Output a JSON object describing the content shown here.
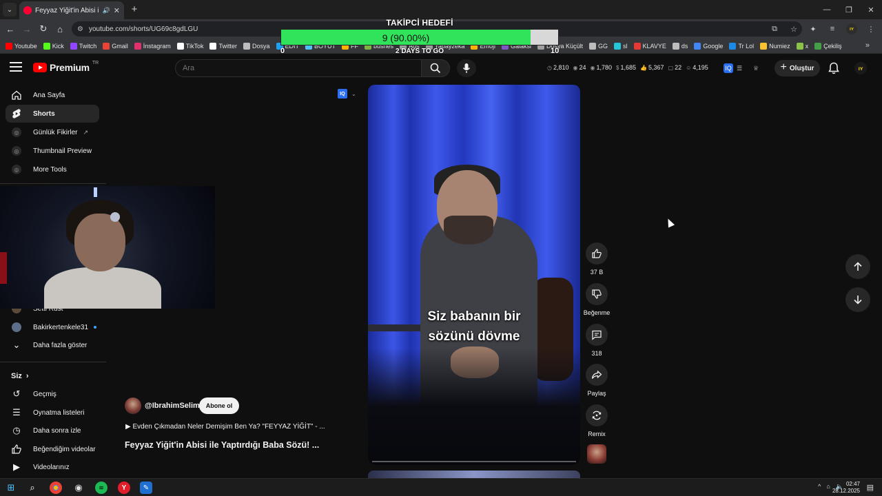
{
  "browser": {
    "tab_title": "Feyyaz Yiğit'in Abisi ile Yaptı",
    "url": "youtube.com/shorts/UG69c8gdLGU",
    "bookmarks": [
      {
        "label": "Youtube",
        "color": "#ff0000"
      },
      {
        "label": "Kick",
        "color": "#53fc18"
      },
      {
        "label": "Twitch",
        "color": "#9146ff"
      },
      {
        "label": "Gmail",
        "color": "#ea4335"
      },
      {
        "label": "İnstagram",
        "color": "#e1306c"
      },
      {
        "label": "TikTok",
        "color": "#ffffff"
      },
      {
        "label": "Twitter",
        "color": "#ffffff"
      },
      {
        "label": "Dosya",
        "color": "#bdbdbd"
      },
      {
        "label": "EDIT",
        "color": "#1da1f2"
      },
      {
        "label": "BOYUT",
        "color": "#4fc3f7"
      },
      {
        "label": "FF",
        "color": "#ffb300"
      },
      {
        "label": "bushes",
        "color": "#7cb342"
      },
      {
        "label": "Ads",
        "color": "#9e9e9e"
      },
      {
        "label": "Yapayzeka",
        "color": "#9e9e9e"
      },
      {
        "label": "Emoji",
        "color": "#ffb300"
      },
      {
        "label": "Galaksi",
        "color": "#7e57c2"
      },
      {
        "label": "Dosya Küçült",
        "color": "#9e9e9e"
      },
      {
        "label": "GG",
        "color": "#bdbdbd"
      },
      {
        "label": "sl",
        "color": "#26c6da"
      },
      {
        "label": "KLAVYE",
        "color": "#e53935"
      },
      {
        "label": "ds",
        "color": "#bdbdbd"
      },
      {
        "label": "Google",
        "color": "#4285f4"
      },
      {
        "label": "Tr Lol",
        "color": "#1e88e5"
      },
      {
        "label": "Numiez",
        "color": "#fbc02d"
      },
      {
        "label": "x",
        "color": "#8bc34a"
      },
      {
        "label": "Çekiliş",
        "color": "#43a047"
      }
    ],
    "more_bookmarks": "»"
  },
  "goal": {
    "title": "TAKİPCİ HEDEFİ",
    "progress_text": "9 (90.00%)",
    "progress": 0.9,
    "start": "0",
    "end": "10",
    "days_left": "2 DAYS TO GO"
  },
  "header": {
    "brand": "Premium",
    "country": "TR",
    "search_placeholder": "Ara",
    "stats": [
      "2,810",
      "24",
      "1,780",
      "1,685",
      "5,367",
      "22",
      "4,195"
    ],
    "create_label": "Oluştur",
    "avatar_initials": "ıʏ"
  },
  "sidebar": {
    "items": [
      {
        "label": "Ana Sayfa",
        "icon": "home-icon"
      },
      {
        "label": "Shorts",
        "icon": "shorts-icon"
      },
      {
        "label": "Günlük Fikirler",
        "icon": "ideas-icon"
      },
      {
        "label": "Thumbnail Preview",
        "icon": "thumbnail-icon"
      },
      {
        "label": "More Tools",
        "icon": "tools-icon"
      }
    ],
    "subscriptions": [
      {
        "label": "Setti Rust"
      },
      {
        "label": "Bakirkertenkele31"
      }
    ],
    "show_more": "Daha fazla göster",
    "you_header": "Siz",
    "you_items": [
      {
        "label": "Geçmiş",
        "icon": "history-icon"
      },
      {
        "label": "Oynatma listeleri",
        "icon": "playlist-icon"
      },
      {
        "label": "Daha sonra izle",
        "icon": "watch-later-icon"
      },
      {
        "label": "Beğendiğim videolar",
        "icon": "liked-icon"
      },
      {
        "label": "Videolarınız",
        "icon": "your-videos-icon"
      }
    ]
  },
  "video": {
    "caption_line1": "Siz babanın bir",
    "caption_line2": "sözünü dövme",
    "channel": "@IbrahimSelim",
    "subscribe_label": "Abone ol",
    "playlist": "▶  Evden Çıkmadan Neler Demişim Ben Ya? \"FEYYAZ YİĞİT\" - ...",
    "title": "Feyyaz Yiğit'in Abisi ile Yaptırdığı Baba Sözü! ..."
  },
  "actions": {
    "likes": "37 B",
    "dislike": "Beğenme",
    "comments": "318",
    "share": "Paylaş",
    "remix": "Remix"
  },
  "taskbar": {
    "time": "02:47",
    "date": "28.12.2025"
  }
}
